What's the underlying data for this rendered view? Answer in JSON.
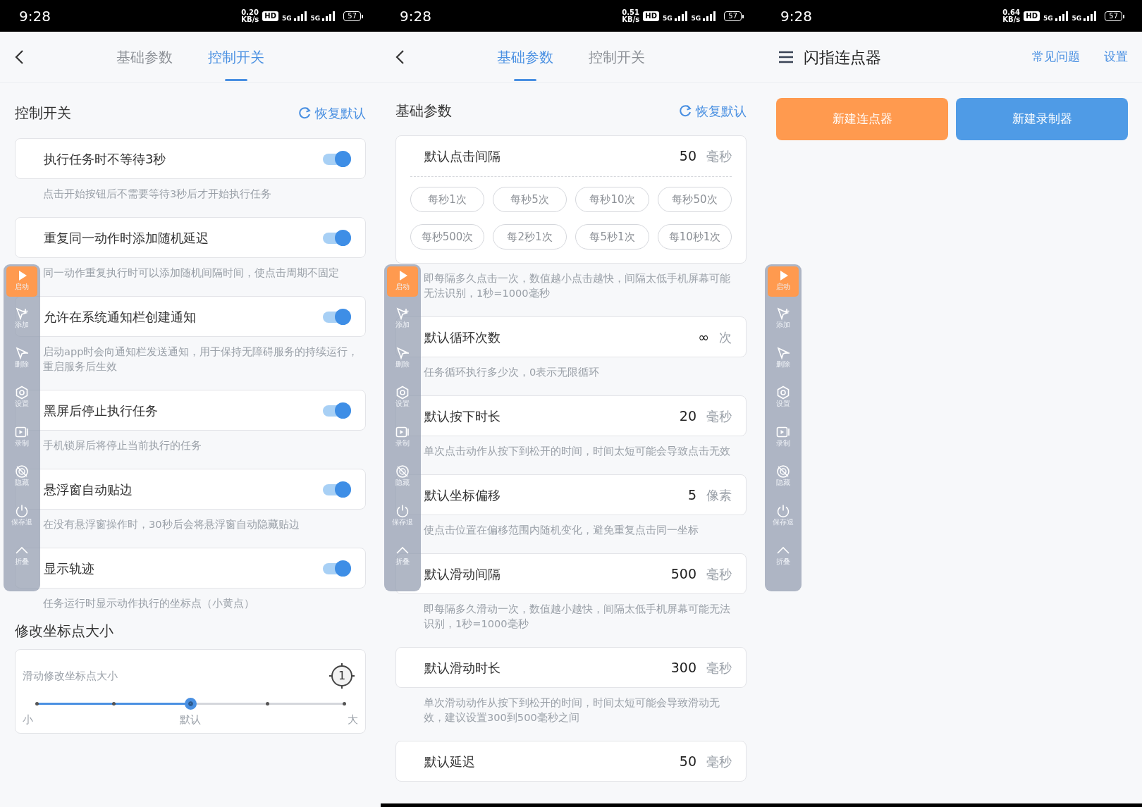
{
  "screens": [
    {
      "kind": "switches",
      "navigation_bar": false,
      "status_bar": {
        "time": "9:28",
        "speed": "0.20",
        "speed_unit": "KB/s",
        "hd": "HD",
        "networks": [
          "5G",
          "5G"
        ],
        "battery": "57"
      },
      "tabs": [
        {
          "label": "基础参数",
          "selected": false
        },
        {
          "label": "控制开关",
          "selected": true
        }
      ],
      "section": {
        "title": "控制开关",
        "reset": "恢复默认"
      },
      "switches": [
        {
          "label": "执行任务时不等待3秒",
          "on": true,
          "hint": "点击开始按钮后不需要等待3秒后才开始执行任务"
        },
        {
          "label": "重复同一动作时添加随机延迟",
          "on": true,
          "hint": "同一动作重复执行时可以添加随机间隔时间，使点击周期不固定"
        },
        {
          "label": "允许在系统通知栏创建通知",
          "on": true,
          "hint": "启动app时会向通知栏发送通知，用于保持无障碍服务的持续运行，重启服务后生效"
        },
        {
          "label": "黑屏后停止执行任务",
          "on": true,
          "hint": "手机锁屏后将停止当前执行的任务"
        },
        {
          "label": "悬浮窗自动贴边",
          "on": true,
          "hint": "在没有悬浮窗操作时，30秒后会将悬浮窗自动隐藏贴边"
        },
        {
          "label": "显示轨迹",
          "on": true,
          "hint": "任务运行时显示动作执行的坐标点（小黄点）"
        }
      ],
      "marker_size": {
        "title": "修改坐标点大小",
        "label": "滑动修改坐标点大小",
        "preview": "1",
        "level": 0.5,
        "min_label": "小",
        "mid_label": "默认",
        "max_label": "大"
      },
      "floating_toolbar": [
        {
          "kind": "start",
          "label": "启动"
        },
        {
          "kind": "add",
          "label": "添加"
        },
        {
          "kind": "remove",
          "label": "删除"
        },
        {
          "kind": "settings",
          "label": "设置"
        },
        {
          "kind": "record",
          "label": "录制"
        },
        {
          "kind": "hide",
          "label": "隐藏"
        },
        {
          "kind": "power",
          "label": "保存退"
        },
        {
          "kind": "collapse",
          "label": "折叠"
        }
      ]
    },
    {
      "kind": "params",
      "navigation_bar": true,
      "status_bar": {
        "time": "9:28",
        "speed": "0.51",
        "speed_unit": "KB/s",
        "hd": "HD",
        "networks": [
          "5G",
          "5G"
        ],
        "battery": "57"
      },
      "tabs": [
        {
          "label": "基础参数",
          "selected": true
        },
        {
          "label": "控制开关",
          "selected": false
        }
      ],
      "section": {
        "title": "基础参数",
        "reset": "恢复默认"
      },
      "params": [
        {
          "label": "默认点击间隔",
          "value": "50",
          "unit": "毫秒",
          "presets": [
            "每秒1次",
            "每秒5次",
            "每秒10次",
            "每秒50次",
            "每秒500次",
            "每2秒1次",
            "每5秒1次",
            "每10秒1次"
          ],
          "hint": "即每隔多久点击一次，数值越小点击越快，间隔太低手机屏幕可能无法识别，1秒=1000毫秒"
        },
        {
          "label": "默认循环次数",
          "value": "∞",
          "unit": "次",
          "hint": "任务循环执行多少次，0表示无限循环"
        },
        {
          "label": "默认按下时长",
          "value": "20",
          "unit": "毫秒",
          "hint": "单次点击动作从按下到松开的时间，时间太短可能会导致点击无效"
        },
        {
          "label": "默认坐标偏移",
          "value": "5",
          "unit": "像素",
          "hint": "使点击位置在偏移范围内随机变化，避免重复点击同一坐标"
        },
        {
          "label": "默认滑动间隔",
          "value": "500",
          "unit": "毫秒",
          "hint": "即每隔多久滑动一次，数值越小越快，间隔太低手机屏幕可能无法识别，1秒=1000毫秒"
        },
        {
          "label": "默认滑动时长",
          "value": "300",
          "unit": "毫秒",
          "hint": "单次滑动动作从按下到松开的时间，时间太短可能会导致滑动无效，建议设置300到500毫秒之间"
        },
        {
          "label": "默认延迟",
          "value": "50",
          "unit": "毫秒"
        }
      ],
      "floating_toolbar": [
        {
          "kind": "start",
          "label": "启动"
        },
        {
          "kind": "add",
          "label": "添加"
        },
        {
          "kind": "remove",
          "label": "删除"
        },
        {
          "kind": "settings",
          "label": "设置"
        },
        {
          "kind": "record",
          "label": "录制"
        },
        {
          "kind": "hide",
          "label": "隐藏"
        },
        {
          "kind": "power",
          "label": "保存退"
        },
        {
          "kind": "collapse",
          "label": "折叠"
        }
      ]
    },
    {
      "kind": "home",
      "navigation_bar": true,
      "status_bar": {
        "time": "9:28",
        "speed": "0.64",
        "speed_unit": "KB/s",
        "hd": "HD",
        "networks": [
          "5G",
          "5G"
        ],
        "battery": "57"
      },
      "title": "闪指连点器",
      "links": [
        "常见问题",
        "设置"
      ],
      "buttons": [
        {
          "label": "新建连点器",
          "color": "#ff9a4f"
        },
        {
          "label": "新建录制器",
          "color": "#4f9be6"
        }
      ],
      "floating_toolbar": [
        {
          "kind": "start",
          "label": "启动"
        },
        {
          "kind": "add",
          "label": "添加"
        },
        {
          "kind": "remove",
          "label": "删除"
        },
        {
          "kind": "settings",
          "label": "设置"
        },
        {
          "kind": "record",
          "label": "录制"
        },
        {
          "kind": "hide",
          "label": "隐藏"
        },
        {
          "kind": "power",
          "label": "保存退"
        },
        {
          "kind": "collapse",
          "label": "折叠"
        }
      ]
    }
  ]
}
